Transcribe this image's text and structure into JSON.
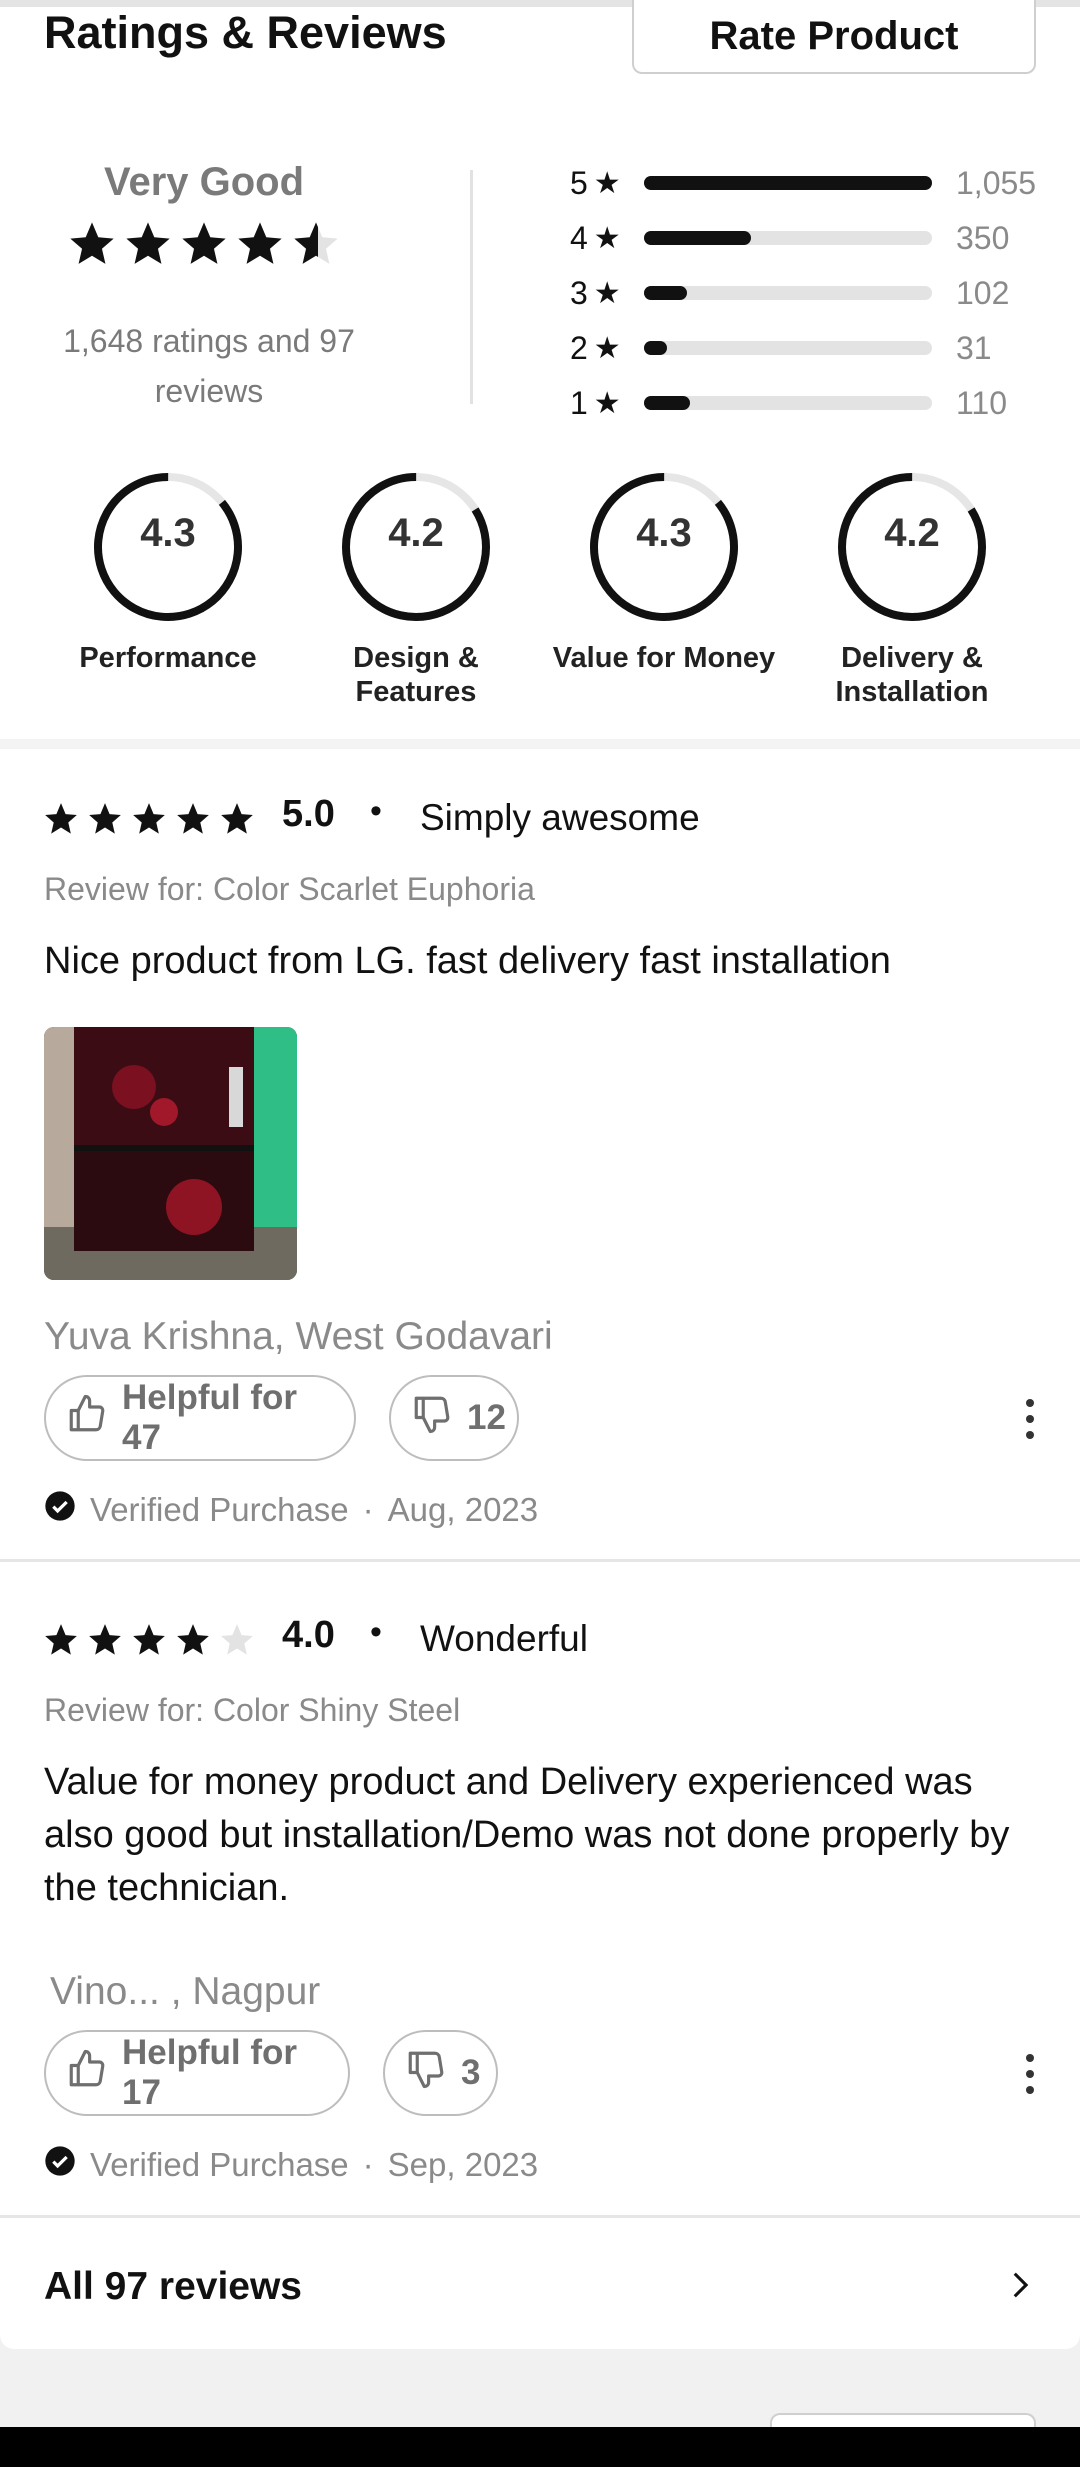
{
  "header": {
    "title": "Ratings & Reviews",
    "rate_button": "Rate Product"
  },
  "summary": {
    "label": "Very Good",
    "rating": 4.3,
    "count_text": "1,648 ratings and 97 reviews"
  },
  "distribution": [
    {
      "star": "5",
      "count": "1,055",
      "fraction": 1.0
    },
    {
      "star": "4",
      "count": "350",
      "fraction": 0.37
    },
    {
      "star": "3",
      "count": "102",
      "fraction": 0.15
    },
    {
      "star": "2",
      "count": "31",
      "fraction": 0.08
    },
    {
      "star": "1",
      "count": "110",
      "fraction": 0.16
    }
  ],
  "aspects": [
    {
      "value": "4.3",
      "label": "Performance",
      "fraction": 0.86
    },
    {
      "value": "4.2",
      "label": "Design & Features",
      "fraction": 0.84
    },
    {
      "value": "4.3",
      "label": "Value for Money",
      "fraction": 0.86
    },
    {
      "value": "4.2",
      "label": "Delivery & Installation",
      "fraction": 0.84
    }
  ],
  "reviews": [
    {
      "stars": 5,
      "score": "5.0",
      "title": "Simply awesome",
      "review_for": "Review for: Color Scarlet Euphoria",
      "text": "Nice product from LG. fast delivery fast installation",
      "author": "Yuva Krishna, West Godavari",
      "helpful": "Helpful for 47",
      "unhelpful": "12",
      "verified": "Verified Purchase",
      "date": "Aug, 2023"
    },
    {
      "stars": 4,
      "score": "4.0",
      "title": "Wonderful",
      "review_for": "Review for: Color Shiny Steel",
      "text": "Value for money product and Delivery experienced was also good but installation/Demo was not done properly by the technician.",
      "author": "Vino... , Nagpur",
      "helpful": "Helpful for 17",
      "unhelpful": "3",
      "verified": "Verified Purchase",
      "date": "Sep, 2023"
    }
  ],
  "all_reviews": "All 97 reviews",
  "colors": {
    "accent": "#111111",
    "muted": "#8a8a8a",
    "track": "#e3e3e3"
  },
  "icons": [
    "star-icon",
    "thumbs-up-icon",
    "thumbs-down-icon",
    "more-vertical-icon",
    "check-circle-icon",
    "chevron-right-icon"
  ]
}
